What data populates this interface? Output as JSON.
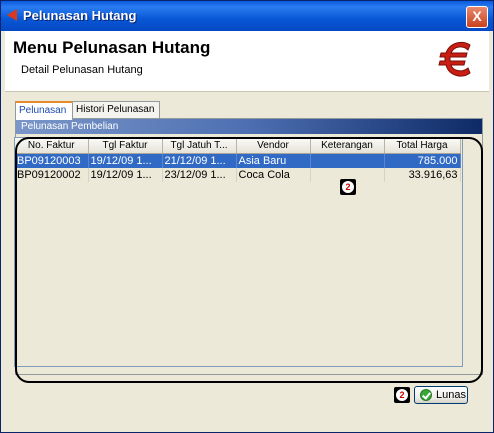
{
  "window": {
    "title": "Pelunasan Hutang",
    "close_label": "X"
  },
  "header": {
    "title": "Menu Pelunasan Hutang",
    "subtitle": "Detail Pelunasan Hutang"
  },
  "tabs": [
    {
      "label": "Pelunasan",
      "active": true
    },
    {
      "label": "Histori Pelunasan",
      "active": false
    }
  ],
  "panel": {
    "section_title": "Pelunasan Pembelian"
  },
  "table": {
    "columns": [
      "No. Faktur",
      "Tgl Faktur",
      "Tgl Jatuh T...",
      "Vendor",
      "Keterangan",
      "Total Harga"
    ],
    "rows": [
      {
        "no_faktur": "BP09120003",
        "tgl_faktur": "19/12/09 1...",
        "tgl_jatuh": "21/12/09 1...",
        "vendor": "Asia Baru",
        "keterangan": "",
        "total": "785.000",
        "selected": true
      },
      {
        "no_faktur": "BP09120002",
        "tgl_faktur": "19/12/09 1...",
        "tgl_jatuh": "23/12/09 1...",
        "vendor": "Coca Cola",
        "keterangan": "",
        "total": "33.916,63",
        "selected": false
      }
    ]
  },
  "markers": [
    "2",
    "2"
  ],
  "actions": {
    "lunas_label": "Lunas"
  },
  "colors": {
    "selection": "#316ac5",
    "titlebar": "#0a5adf",
    "accent_tab": "#e68b2c"
  },
  "icons": {
    "app": "app-icon",
    "header": "euro-icon",
    "lunas": "check-icon"
  }
}
